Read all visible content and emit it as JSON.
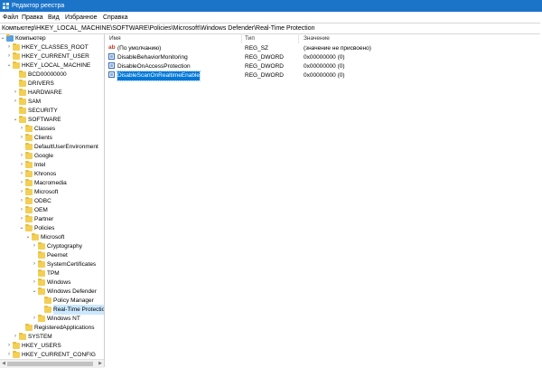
{
  "window": {
    "title": "Редактор реестра"
  },
  "menu": [
    "Файл",
    "Правка",
    "Вид",
    "Избранное",
    "Справка"
  ],
  "address": "Компьютер\\HKEY_LOCAL_MACHINE\\SOFTWARE\\Policies\\Microsoft\\Windows Defender\\Real-Time Protection",
  "tree": [
    {
      "label": "Компьютер",
      "level": 0,
      "arrow": "v",
      "folder": false
    },
    {
      "label": "HKEY_CLASSES_ROOT",
      "level": 1,
      "arrow": ">",
      "folder": true
    },
    {
      "label": "HKEY_CURRENT_USER",
      "level": 1,
      "arrow": ">",
      "folder": true
    },
    {
      "label": "HKEY_LOCAL_MACHINE",
      "level": 1,
      "arrow": "v",
      "folder": true
    },
    {
      "label": "BCD00000000",
      "level": 2,
      "arrow": "",
      "folder": true
    },
    {
      "label": "DRIVERS",
      "level": 2,
      "arrow": "",
      "folder": true
    },
    {
      "label": "HARDWARE",
      "level": 2,
      "arrow": ">",
      "folder": true
    },
    {
      "label": "SAM",
      "level": 2,
      "arrow": ">",
      "folder": true
    },
    {
      "label": "SECURITY",
      "level": 2,
      "arrow": "",
      "folder": true
    },
    {
      "label": "SOFTWARE",
      "level": 2,
      "arrow": "v",
      "folder": true
    },
    {
      "label": "Classes",
      "level": 3,
      "arrow": ">",
      "folder": true
    },
    {
      "label": "Clients",
      "level": 3,
      "arrow": ">",
      "folder": true
    },
    {
      "label": "DefaultUserEnvironment",
      "level": 3,
      "arrow": "",
      "folder": true
    },
    {
      "label": "Google",
      "level": 3,
      "arrow": ">",
      "folder": true
    },
    {
      "label": "Intel",
      "level": 3,
      "arrow": ">",
      "folder": true
    },
    {
      "label": "Khronos",
      "level": 3,
      "arrow": ">",
      "folder": true
    },
    {
      "label": "Macromedia",
      "level": 3,
      "arrow": ">",
      "folder": true
    },
    {
      "label": "Microsoft",
      "level": 3,
      "arrow": ">",
      "folder": true
    },
    {
      "label": "ODBC",
      "level": 3,
      "arrow": ">",
      "folder": true
    },
    {
      "label": "OEM",
      "level": 3,
      "arrow": ">",
      "folder": true
    },
    {
      "label": "Partner",
      "level": 3,
      "arrow": ">",
      "folder": true
    },
    {
      "label": "Policies",
      "level": 3,
      "arrow": "v",
      "folder": true
    },
    {
      "label": "Microsoft",
      "level": 4,
      "arrow": "v",
      "folder": true
    },
    {
      "label": "Cryptography",
      "level": 5,
      "arrow": ">",
      "folder": true
    },
    {
      "label": "Peernet",
      "level": 5,
      "arrow": "",
      "folder": true
    },
    {
      "label": "SystemCertificates",
      "level": 5,
      "arrow": ">",
      "folder": true
    },
    {
      "label": "TPM",
      "level": 5,
      "arrow": "",
      "folder": true
    },
    {
      "label": "Windows",
      "level": 5,
      "arrow": ">",
      "folder": true
    },
    {
      "label": "Windows Defender",
      "level": 5,
      "arrow": "v",
      "folder": true
    },
    {
      "label": "Policy Manager",
      "level": 6,
      "arrow": "",
      "folder": true
    },
    {
      "label": "Real-Time Protection",
      "level": 6,
      "arrow": "",
      "folder": true,
      "selected": true
    },
    {
      "label": "Windows NT",
      "level": 5,
      "arrow": ">",
      "folder": true
    },
    {
      "label": "RegisteredApplications",
      "level": 3,
      "arrow": "",
      "folder": true
    },
    {
      "label": "SYSTEM",
      "level": 2,
      "arrow": ">",
      "folder": true
    },
    {
      "label": "HKEY_USERS",
      "level": 1,
      "arrow": ">",
      "folder": true
    },
    {
      "label": "HKEY_CURRENT_CONFIG",
      "level": 1,
      "arrow": ">",
      "folder": true
    }
  ],
  "columns": {
    "name": "Имя",
    "type": "Тип",
    "value": "Значение"
  },
  "values": [
    {
      "icon": "string-value-icon",
      "name": "(По умолчанию)",
      "type": "REG_SZ",
      "data": "(значение не присвоено)"
    },
    {
      "icon": "dword-value-icon",
      "name": "DisableBehaviorMonitoring",
      "type": "REG_DWORD",
      "data": "0x00000000 (0)"
    },
    {
      "icon": "dword-value-icon",
      "name": "DisableOnAccessProtection",
      "type": "REG_DWORD",
      "data": "0x00000000 (0)"
    },
    {
      "icon": "dword-value-icon",
      "name": "DisableScanOnRealtimeEnable",
      "type": "REG_DWORD",
      "data": "0x00000000 (0)",
      "selected": true
    }
  ],
  "colors": {
    "titlebar": "#1c74c9",
    "selection": "#0078d7",
    "tree_selection": "#cce8ff",
    "folder": "#f3cf55"
  }
}
